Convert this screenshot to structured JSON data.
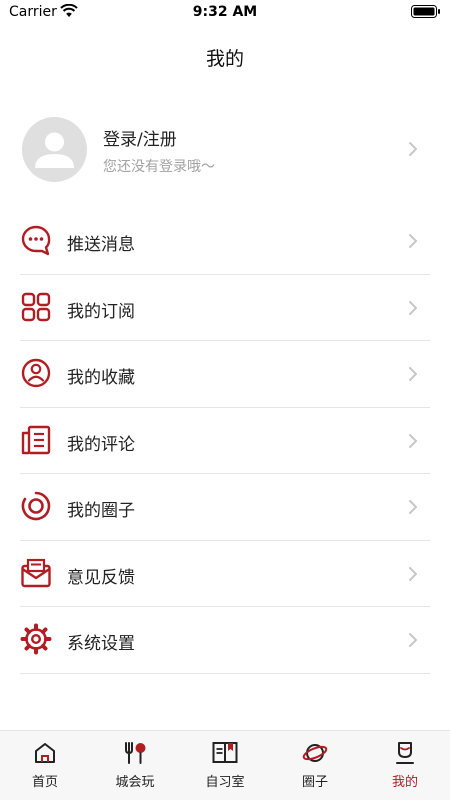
{
  "status_bar": {
    "carrier": "Carrier",
    "time": "9:32 AM"
  },
  "nav": {
    "title": "我的"
  },
  "profile": {
    "title": "登录/注册",
    "subtitle": "您还没有登录哦～"
  },
  "colors": {
    "accent": "#b01e23",
    "chevron": "#c7c7c7",
    "avatar_bg": "#dfdfdf"
  },
  "menu": [
    {
      "label": "推送消息",
      "icon": "chat-bubble-icon"
    },
    {
      "label": "我的订阅",
      "icon": "grid-icon"
    },
    {
      "label": "我的收藏",
      "icon": "user-circle-icon"
    },
    {
      "label": "我的评论",
      "icon": "document-icon"
    },
    {
      "label": "我的圈子",
      "icon": "ring-icon"
    },
    {
      "label": "意见反馈",
      "icon": "envelope-icon"
    },
    {
      "label": "系统设置",
      "icon": "gear-icon"
    }
  ],
  "tabs": [
    {
      "label": "首页",
      "icon": "home-icon"
    },
    {
      "label": "城会玩",
      "icon": "fork-spoon-icon"
    },
    {
      "label": "自习室",
      "icon": "book-icon"
    },
    {
      "label": "圈子",
      "icon": "planet-icon"
    },
    {
      "label": "我的",
      "icon": "mine-icon",
      "active": true
    }
  ]
}
